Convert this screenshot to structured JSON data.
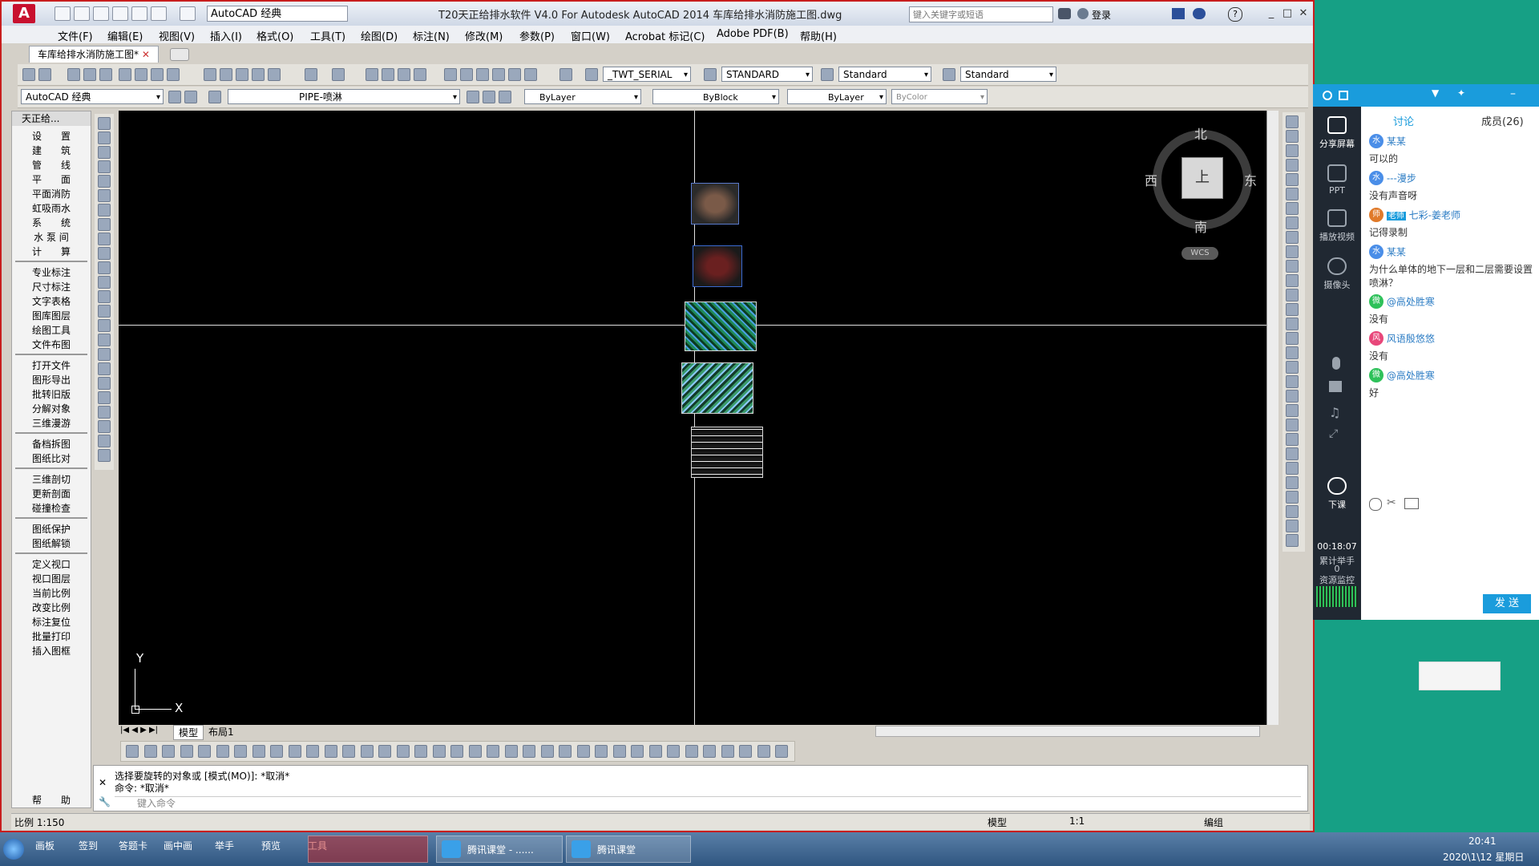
{
  "titlebar": {
    "workspace": "AutoCAD 经典",
    "title": "T20天正给排水软件 V4.0 For Autodesk AutoCAD 2014    车库给排水消防施工图.dwg",
    "search_placeholder": "键入关键字或短语",
    "login": "登录"
  },
  "menu": [
    "文件(F)",
    "编辑(E)",
    "视图(V)",
    "插入(I)",
    "格式(O)",
    "工具(T)",
    "绘图(D)",
    "标注(N)",
    "修改(M)",
    "参数(P)",
    "窗口(W)",
    "Acrobat 标记(C)",
    "Adobe PDF(B)",
    "帮助(H)"
  ],
  "doc_tab": "车库给排水消防施工图*",
  "toolbar1": {
    "text_style": "_TWT_SERIAL",
    "dim_style": "STANDARD",
    "table_style": "Standard",
    "mleader_style": "Standard"
  },
  "toolbar2": {
    "workspace": "AutoCAD 经典",
    "layer": "PIPE-喷淋",
    "color": "ByLayer",
    "linetype": "ByBlock",
    "lineweight": "ByLayer",
    "plotstyle": "ByColor"
  },
  "palette": {
    "title": "天正给...",
    "groups": [
      [
        "设　　置",
        "建　　筑",
        "管　　线",
        "平　　面",
        "平面消防",
        "虹吸雨水",
        "系　　统",
        "水 泵 间",
        "计　　算"
      ],
      [
        "专业标注",
        "尺寸标注",
        "文字表格",
        "图库图层",
        "绘图工具",
        "文件布图"
      ],
      [
        "打开文件",
        "图形导出",
        "批转旧版",
        "分解对象",
        "三维漫游"
      ],
      [
        "备档拆图",
        "图纸比对"
      ],
      [
        "三维剖切",
        "更新剖面",
        "碰撞检查"
      ],
      [
        "图纸保护",
        "图纸解锁"
      ],
      [
        "定义视口",
        "视口图层",
        "当前比例",
        "改变比例",
        "标注复位",
        "批量打印",
        "插入图框"
      ]
    ],
    "help": "帮　　助"
  },
  "viewcube": {
    "north": "北",
    "south": "南",
    "west": "西",
    "east": "东",
    "face": "上",
    "wcs": "WCS"
  },
  "ucs": {
    "x": "X",
    "y": "Y"
  },
  "layout_tabs": [
    "模型",
    "布局1"
  ],
  "command": {
    "line1": "选择要旋转的对象或 [模式(MO)]: *取消*",
    "line2": "命令: *取消*",
    "placeholder": "键入命令"
  },
  "statusbar": {
    "scale": "比例 1:150",
    "model": "模型",
    "ann_scale": "1:1",
    "edit": "编组"
  },
  "chat": {
    "tabs": [
      "讨论",
      "成员(26)"
    ],
    "side": [
      "分享屏幕",
      "PPT",
      "播放视频",
      "摄像头",
      "下课"
    ],
    "timer": "00:18:07",
    "raise_hand": "累计举手",
    "raise_count": "0",
    "monitor": "资源监控",
    "messages": [
      {
        "name": "某某",
        "text": "可以的",
        "color": "#4a8ee8",
        "icon": "水"
      },
      {
        "name": "---漫步",
        "text": "没有声音呀",
        "color": "#4a8ee8",
        "icon": "水"
      },
      {
        "name": "七彩-姜老师",
        "text": "记得录制",
        "color": "#e07a2a",
        "icon": "师",
        "teacher": "老师"
      },
      {
        "name": "某某",
        "text": "为什么单体的地下一层和二层需要设置喷淋？",
        "color": "#4a8ee8",
        "icon": "水"
      },
      {
        "name": "@高处胜寒",
        "text": "没有",
        "color": "#2ec15a",
        "icon": "微"
      },
      {
        "name": "风语殷悠悠",
        "text": "没有",
        "color": "#e8477a",
        "icon": "风"
      },
      {
        "name": "@高处胜寒",
        "text": "好",
        "color": "#2ec15a",
        "icon": "微"
      }
    ],
    "send": "发 送"
  },
  "taskbar": {
    "tabs": [
      "画板",
      "签到",
      "答题卡",
      "画中画",
      "举手",
      "预览",
      "工具"
    ],
    "apps": [
      "腾讯课堂 - ......",
      "腾讯课堂"
    ],
    "time": "20:41",
    "date": "2020\\1\\12 星期日"
  }
}
